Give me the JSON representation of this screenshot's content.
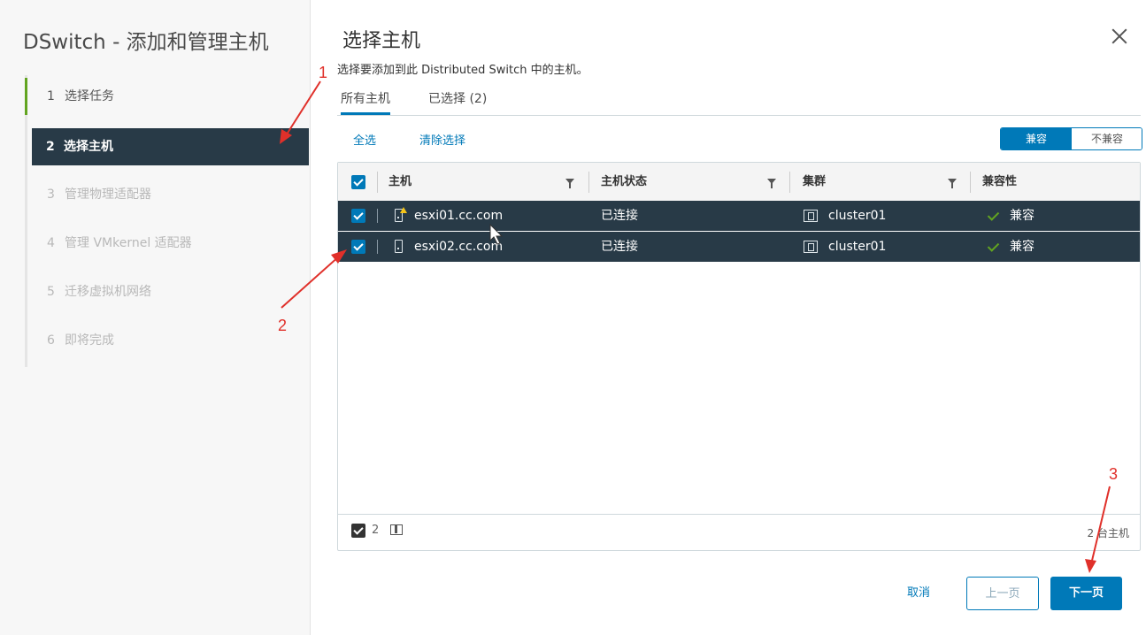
{
  "wizard": {
    "title": "DSwitch - 添加和管理主机",
    "steps": [
      {
        "num": "1",
        "label": "选择任务",
        "state": "done"
      },
      {
        "num": "2",
        "label": "选择主机",
        "state": "active"
      },
      {
        "num": "3",
        "label": "管理物理适配器",
        "state": "todo"
      },
      {
        "num": "4",
        "label": "管理 VMkernel 适配器",
        "state": "todo"
      },
      {
        "num": "5",
        "label": "迁移虚拟机网络",
        "state": "todo"
      },
      {
        "num": "6",
        "label": "即将完成",
        "state": "todo"
      }
    ]
  },
  "page": {
    "title": "选择主机",
    "description": "选择要添加到此 Distributed Switch 中的主机。",
    "tabs": [
      {
        "label": "所有主机",
        "active": true
      },
      {
        "label": "已选择 (2)",
        "active": false
      }
    ],
    "select_all": "全选",
    "clear_selection": "清除选择",
    "toggle": {
      "on": "兼容",
      "off": "不兼容"
    }
  },
  "grid": {
    "columns": [
      "主机",
      "主机状态",
      "集群",
      "兼容性"
    ],
    "rows": [
      {
        "host": "esxi01.cc.com",
        "status": "已连接",
        "cluster": "cluster01",
        "compat": "兼容",
        "checked": true,
        "warning": true
      },
      {
        "host": "esxi02.cc.com",
        "status": "已连接",
        "cluster": "cluster01",
        "compat": "兼容",
        "checked": true,
        "warning": false
      }
    ],
    "footer": {
      "selected_count": "2",
      "total": "2 台主机"
    }
  },
  "buttons": {
    "cancel": "取消",
    "prev": "上一页",
    "next": "下一页"
  },
  "annotations": {
    "a1": "1",
    "a2": "2",
    "a3": "3"
  },
  "colors": {
    "accent": "#0079b8",
    "active_bg": "#283a47",
    "success": "#62a420",
    "annotation": "#e0302a"
  }
}
